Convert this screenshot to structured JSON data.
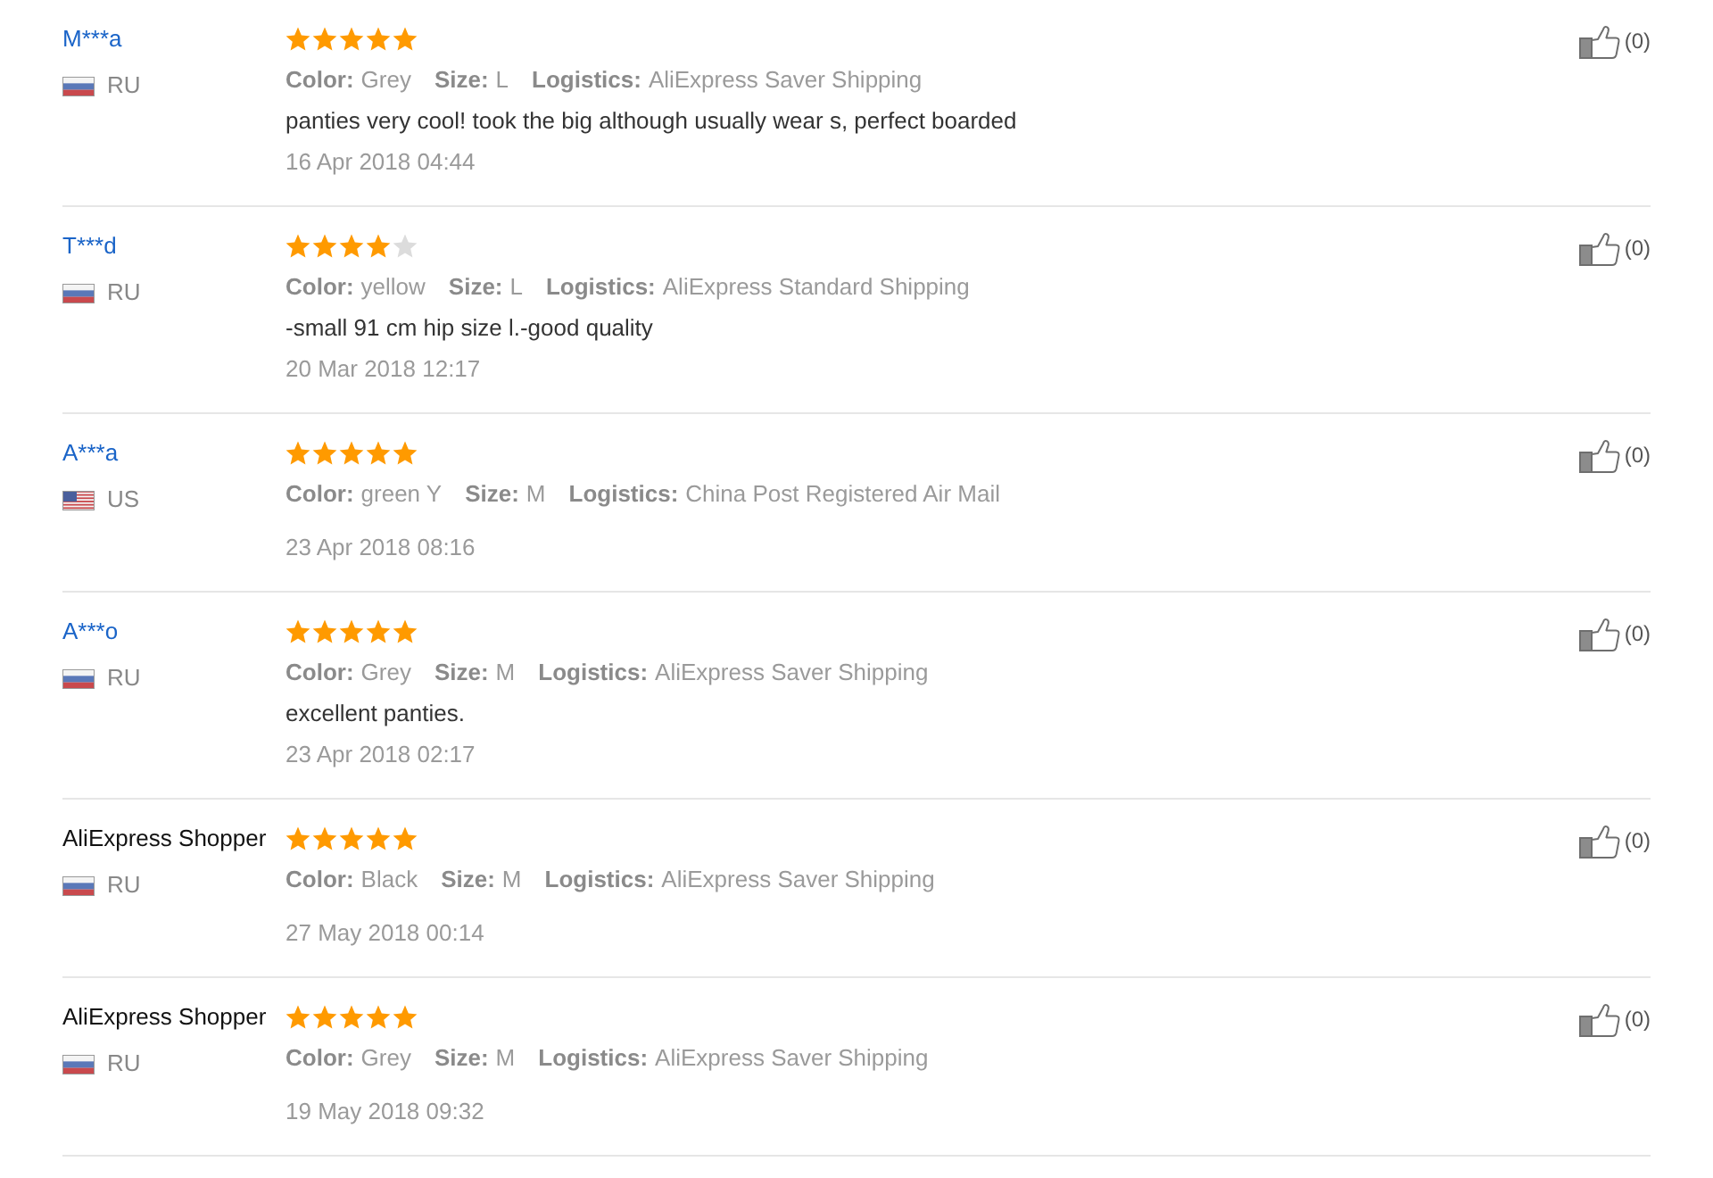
{
  "reviews": [
    {
      "name": {
        "text": "M***a",
        "kind": "link"
      },
      "country": {
        "code": "RU",
        "kind": "russia"
      },
      "stars": 5,
      "attributes": [
        {
          "label": "Color:",
          "value": "Grey"
        },
        {
          "label": "Size:",
          "value": "L"
        },
        {
          "label": "Logistics:",
          "value": "AliExpress Saver Shipping"
        }
      ],
      "comment": "panties very cool! took the big although usually wear s, perfect boarded",
      "date": "16 Apr 2018 04:44",
      "likes": "(0)"
    },
    {
      "name": {
        "text": "T***d",
        "kind": "link"
      },
      "country": {
        "code": "RU",
        "kind": "russia"
      },
      "stars": 4,
      "attributes": [
        {
          "label": "Color:",
          "value": "yellow"
        },
        {
          "label": "Size:",
          "value": "L"
        },
        {
          "label": "Logistics:",
          "value": "AliExpress Standard Shipping"
        }
      ],
      "comment": "-small 91 cm hip size l.-good quality",
      "date": "20 Mar 2018 12:17",
      "likes": "(0)"
    },
    {
      "name": {
        "text": "A***a",
        "kind": "link"
      },
      "country": {
        "code": "US",
        "kind": "usa"
      },
      "stars": 5,
      "attributes": [
        {
          "label": "Color:",
          "value": "green Y"
        },
        {
          "label": "Size:",
          "value": "M"
        },
        {
          "label": "Logistics:",
          "value": "China Post Registered Air Mail"
        }
      ],
      "date": "23 Apr 2018 08:16",
      "likes": "(0)"
    },
    {
      "name": {
        "text": "A***o",
        "kind": "link"
      },
      "country": {
        "code": "RU",
        "kind": "russia"
      },
      "stars": 5,
      "attributes": [
        {
          "label": "Color:",
          "value": "Grey"
        },
        {
          "label": "Size:",
          "value": "M"
        },
        {
          "label": "Logistics:",
          "value": "AliExpress Saver Shipping"
        }
      ],
      "comment": "excellent panties.",
      "date": "23 Apr 2018 02:17",
      "likes": "(0)"
    },
    {
      "name": {
        "text": "AliExpress Shopper",
        "kind": "plain"
      },
      "country": {
        "code": "RU",
        "kind": "russia"
      },
      "stars": 5,
      "attributes": [
        {
          "label": "Color:",
          "value": "Black"
        },
        {
          "label": "Size:",
          "value": "M"
        },
        {
          "label": "Logistics:",
          "value": "AliExpress Saver Shipping"
        }
      ],
      "date": "27 May 2018 00:14",
      "likes": "(0)"
    },
    {
      "name": {
        "text": "AliExpress Shopper",
        "kind": "plain"
      },
      "country": {
        "code": "RU",
        "kind": "russia"
      },
      "stars": 5,
      "attributes": [
        {
          "label": "Color:",
          "value": "Grey"
        },
        {
          "label": "Size:",
          "value": "M"
        },
        {
          "label": "Logistics:",
          "value": "AliExpress Saver Shipping"
        }
      ],
      "date": "19 May 2018 09:32",
      "likes": "(0)"
    }
  ]
}
